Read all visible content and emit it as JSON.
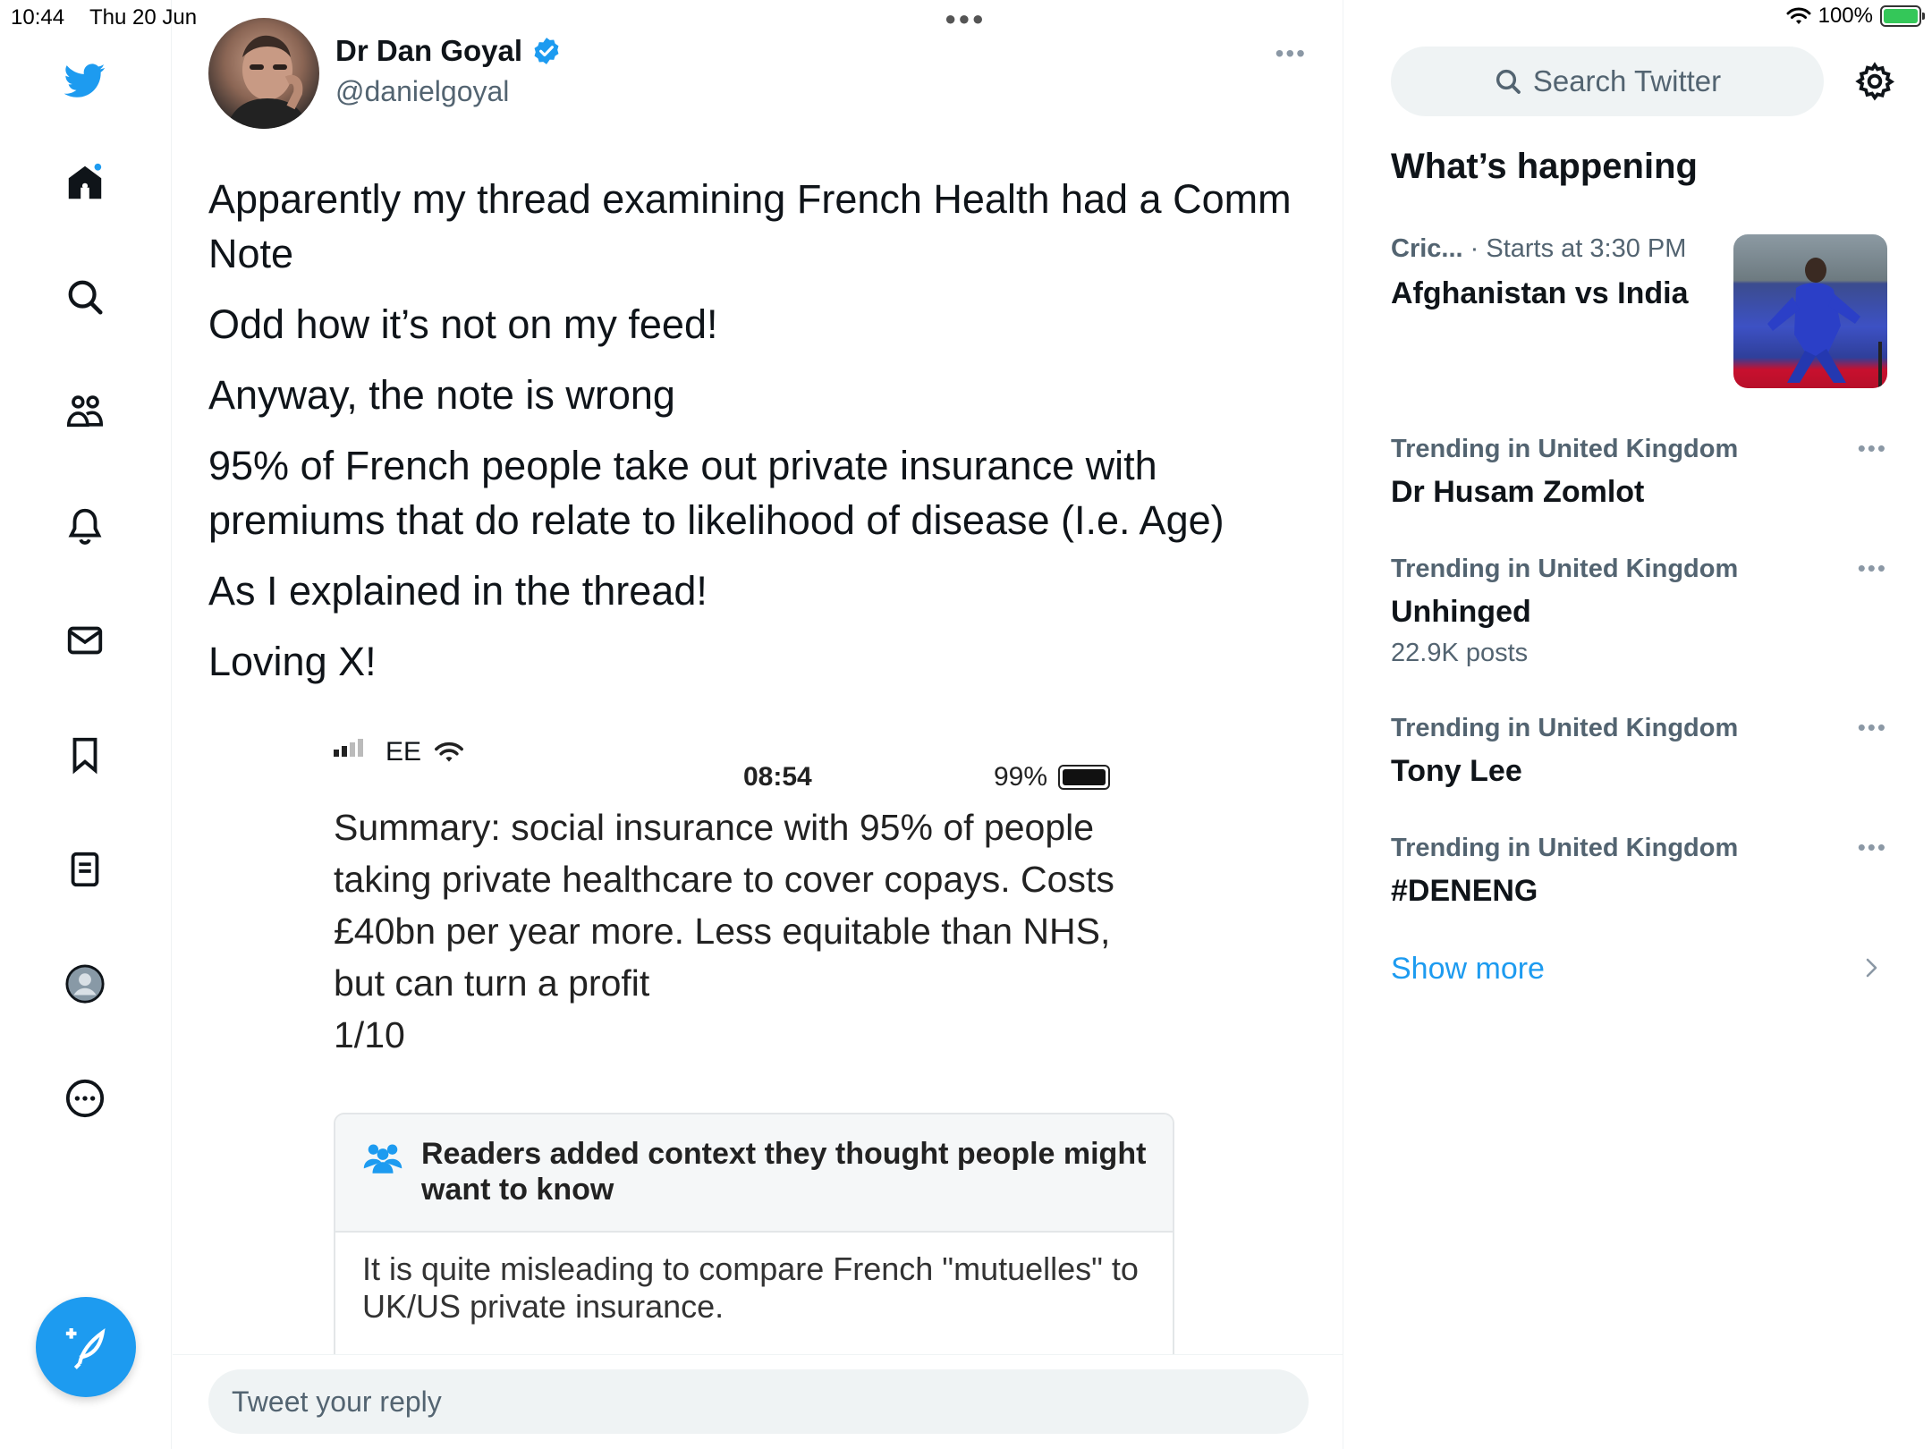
{
  "status_bar": {
    "time": "10:44",
    "date": "Thu 20 Jun",
    "battery": "100%"
  },
  "nav": {
    "icons": [
      "twitter-bird-icon",
      "home-icon",
      "explore-icon",
      "communities-icon",
      "notifications-icon",
      "messages-icon",
      "bookmarks-icon",
      "lists-icon",
      "profile-icon",
      "more-icon"
    ],
    "compose_icon": "compose-feather-icon",
    "home_has_new": true
  },
  "tweet": {
    "author_name": "Dr Dan Goyal",
    "author_handle": "@danielgoyal",
    "verified": true,
    "paragraphs": [
      "Apparently my thread examining French Health had a Comm Note",
      "Odd how it’s not on my feed!",
      "Anyway, the note is wrong",
      "95% of French people take out private insurance with premiums that do relate to likelihood of disease (I.e. Age)",
      "As I explained in the thread!",
      "Loving X!"
    ],
    "media": {
      "carrier": "EE",
      "time": "08:54",
      "battery": "99%",
      "summary_lines": [
        "Summary: social insurance with 95% of people",
        "taking private healthcare to cover copays. Costs",
        "£40bn per year more. Less equitable than NHS,",
        "but can turn a profit",
        "1/10"
      ],
      "note_title": "Readers added context they thought people might want to know",
      "note_body": "It is quite misleading to compare French \"mutuelles\" to UK/US private insurance."
    }
  },
  "reply": {
    "placeholder": "Tweet your reply"
  },
  "sidebar": {
    "search_placeholder": "Search Twitter",
    "whats_happening_title": "What’s happening",
    "event": {
      "category": "Cric...",
      "time": "· Starts at 3:30 PM",
      "title": "Afghanistan vs India"
    },
    "trends": [
      {
        "category": "Trending in United Kingdom",
        "name": "Dr Husam Zomlot",
        "posts": ""
      },
      {
        "category": "Trending in United Kingdom",
        "name": "Unhinged",
        "posts": "22.9K posts"
      },
      {
        "category": "Trending in United Kingdom",
        "name": "Tony Lee",
        "posts": ""
      },
      {
        "category": "Trending in United Kingdom",
        "name": "#DENENG",
        "posts": ""
      }
    ],
    "show_more": "Show more"
  },
  "colors": {
    "accent": "#1d9bf0",
    "text_primary": "#0f1419",
    "text_secondary": "#536471",
    "border": "#eff3f4"
  }
}
